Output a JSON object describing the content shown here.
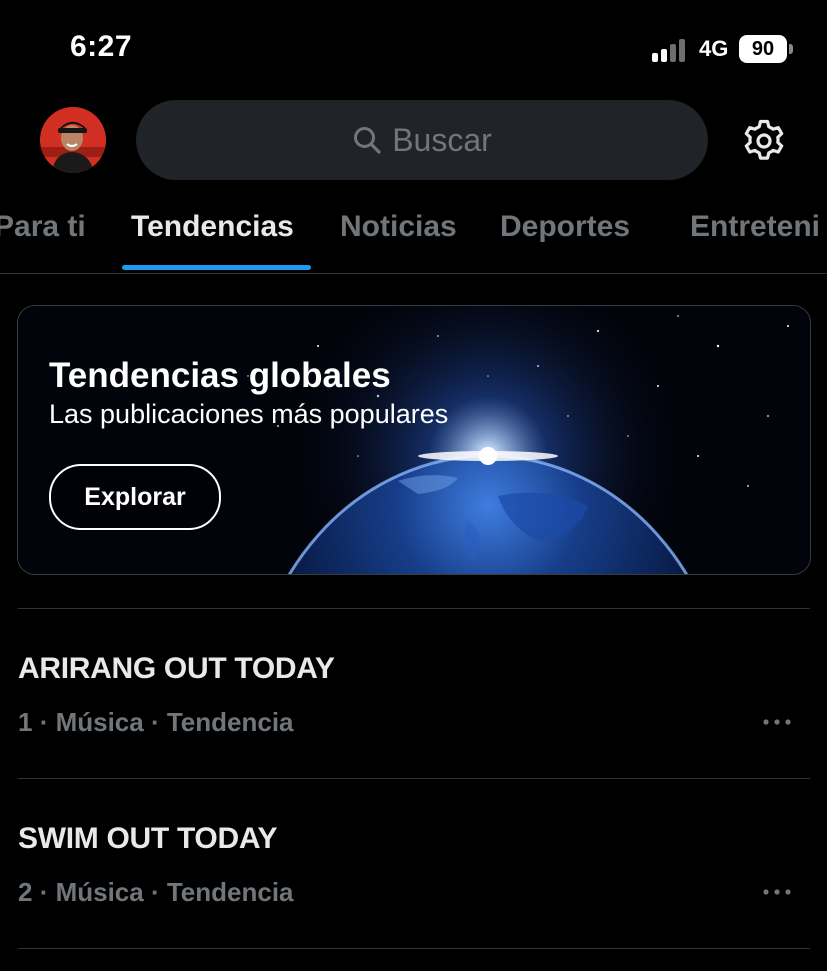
{
  "status": {
    "time": "6:27",
    "network": "4G",
    "battery": "90"
  },
  "header": {
    "search_placeholder": "Buscar"
  },
  "tabs": [
    {
      "label": "Para ti",
      "active": false
    },
    {
      "label": "Tendencias",
      "active": true
    },
    {
      "label": "Noticias",
      "active": false
    },
    {
      "label": "Deportes",
      "active": false
    },
    {
      "label": "Entreteni",
      "active": false
    }
  ],
  "banner": {
    "title": "Tendencias globales",
    "subtitle": "Las publicaciones más populares",
    "button_label": "Explorar"
  },
  "trends": [
    {
      "title": "ARIRANG OUT TODAY",
      "rank": "1",
      "category": "Música",
      "label": "Tendencia"
    },
    {
      "title": "SWIM OUT TODAY",
      "rank": "2",
      "category": "Música",
      "label": "Tendencia"
    }
  ],
  "icons": {
    "search": "search-icon",
    "settings": "gear-icon",
    "more": "more-dots-icon",
    "signal": "signal-icon",
    "battery": "battery-icon",
    "avatar": "avatar"
  },
  "colors": {
    "accent": "#1d9bf0",
    "muted": "#71767b",
    "background": "#000000",
    "input": "#202327"
  }
}
